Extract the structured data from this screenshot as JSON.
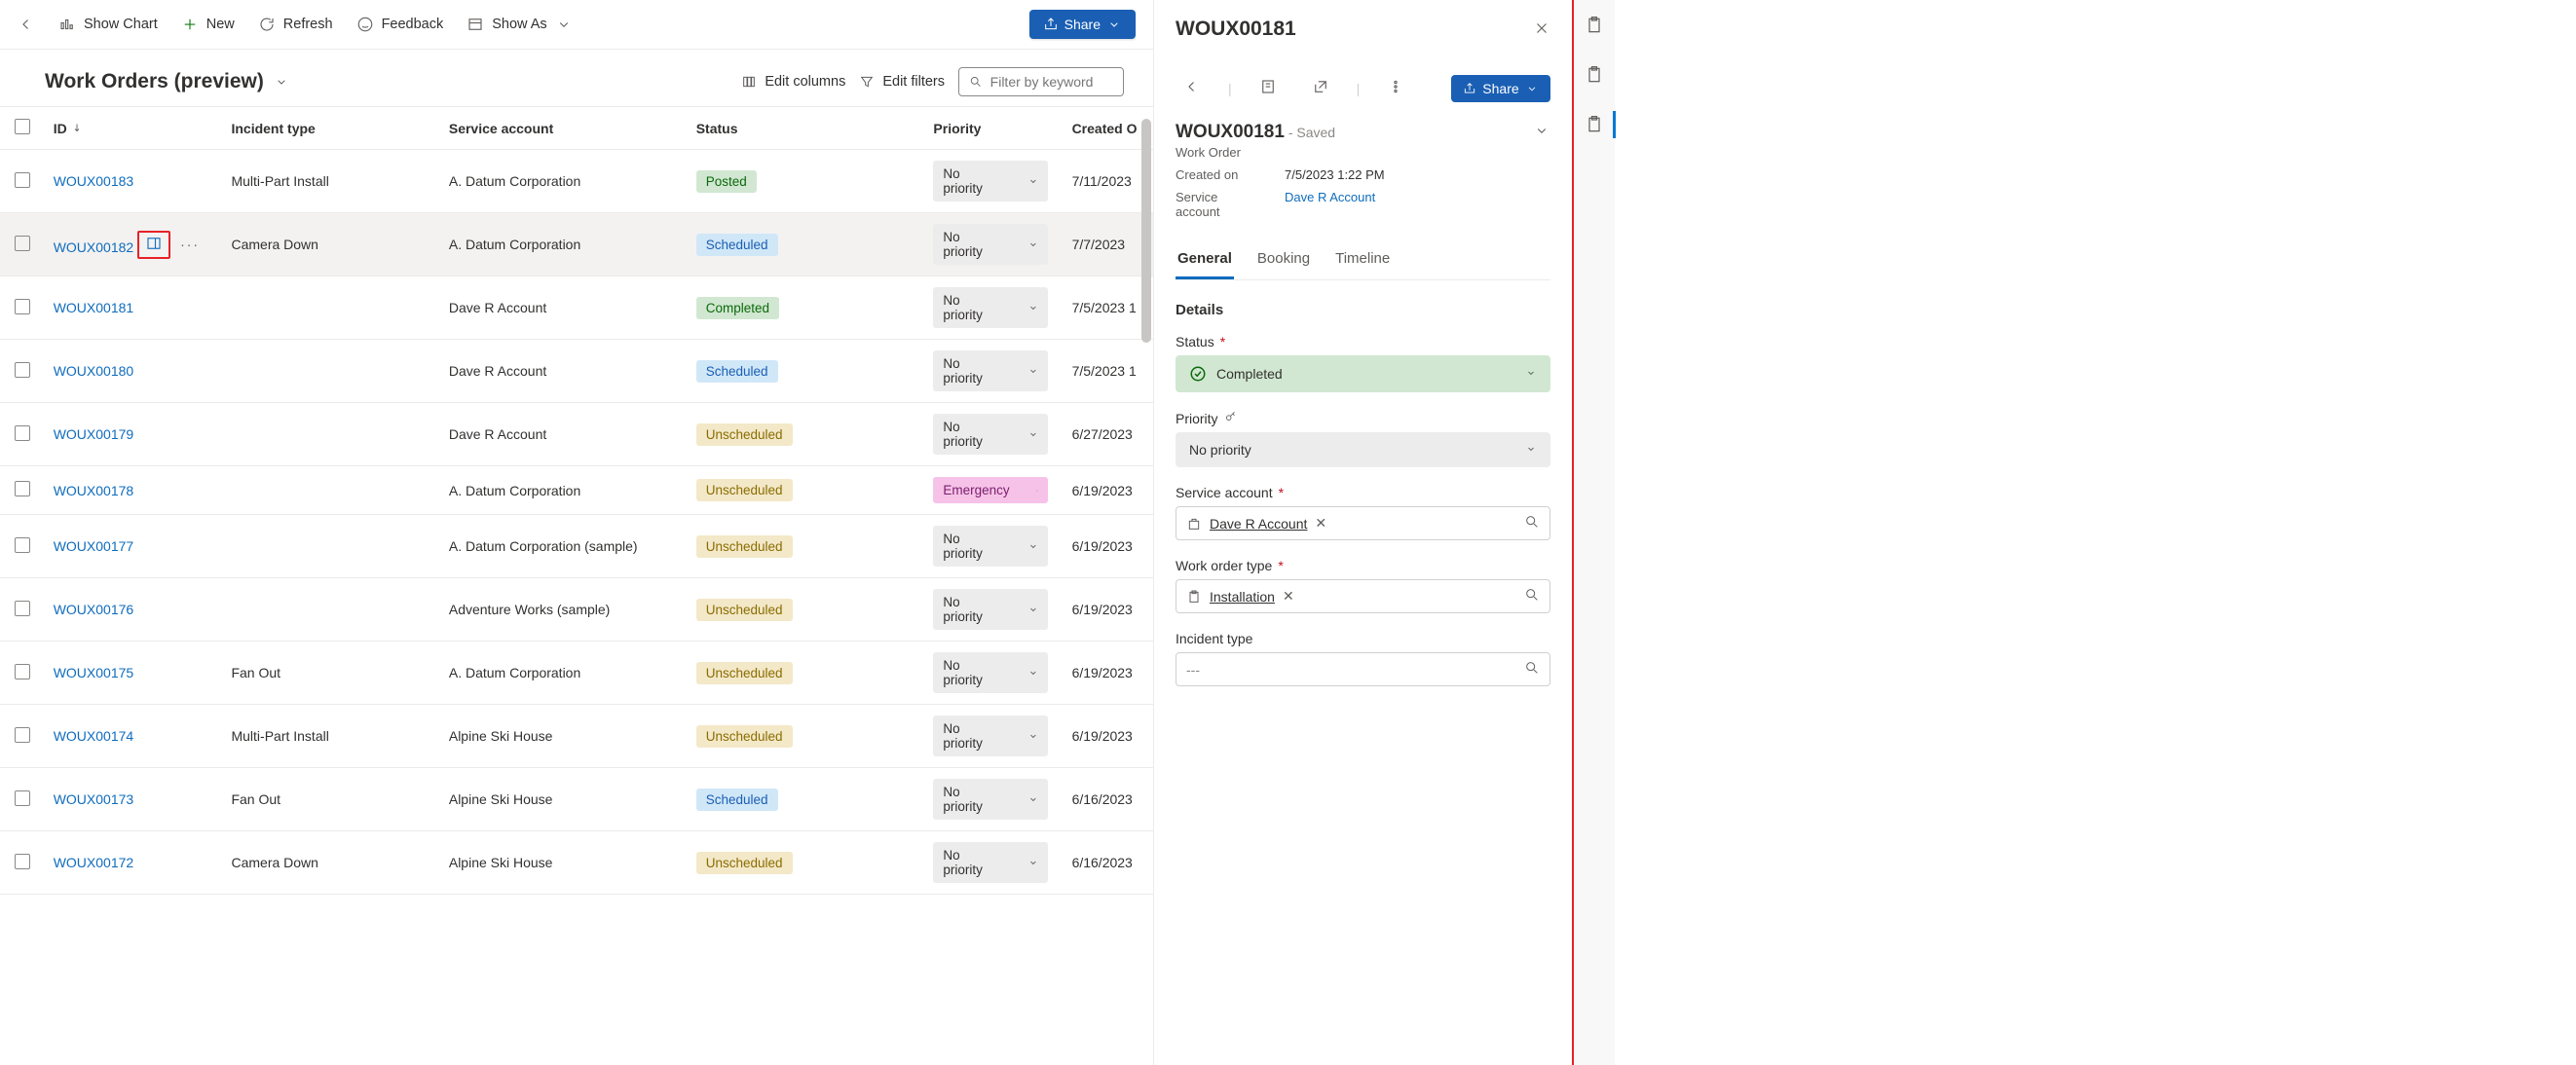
{
  "commandBar": {
    "showChart": "Show Chart",
    "new": "New",
    "refresh": "Refresh",
    "feedback": "Feedback",
    "showAs": "Show As",
    "share": "Share"
  },
  "viewHeader": {
    "title": "Work Orders (preview)",
    "editColumns": "Edit columns",
    "editFilters": "Edit filters",
    "filterPlaceholder": "Filter by keyword"
  },
  "columns": {
    "id": "ID",
    "incident": "Incident type",
    "account": "Service account",
    "status": "Status",
    "priority": "Priority",
    "created": "Created O"
  },
  "rows": [
    {
      "id": "WOUX00183",
      "incident": "Multi-Part Install",
      "account": "A. Datum Corporation",
      "status": "Posted",
      "statusClass": "st-posted",
      "priority": "No priority",
      "prioClass": "",
      "created": "7/11/2023"
    },
    {
      "id": "WOUX00182",
      "hover": true,
      "actions": true,
      "incident": "Camera Down",
      "account": "A. Datum Corporation",
      "status": "Scheduled",
      "statusClass": "st-scheduled",
      "priority": "No priority",
      "prioClass": "",
      "created": "7/7/2023"
    },
    {
      "id": "WOUX00181",
      "incident": "",
      "account": "Dave R Account",
      "status": "Completed",
      "statusClass": "st-completed",
      "priority": "No priority",
      "prioClass": "",
      "created": "7/5/2023 1"
    },
    {
      "id": "WOUX00180",
      "incident": "",
      "account": "Dave R Account",
      "status": "Scheduled",
      "statusClass": "st-scheduled",
      "priority": "No priority",
      "prioClass": "",
      "created": "7/5/2023 1"
    },
    {
      "id": "WOUX00179",
      "incident": "",
      "account": "Dave R Account",
      "status": "Unscheduled",
      "statusClass": "st-unscheduled",
      "priority": "No priority",
      "prioClass": "",
      "created": "6/27/2023"
    },
    {
      "id": "WOUX00178",
      "incident": "",
      "account": "A. Datum Corporation",
      "status": "Unscheduled",
      "statusClass": "st-unscheduled",
      "priority": "Emergency",
      "prioClass": "emerg",
      "created": "6/19/2023"
    },
    {
      "id": "WOUX00177",
      "incident": "",
      "account": "A. Datum Corporation (sample)",
      "status": "Unscheduled",
      "statusClass": "st-unscheduled",
      "priority": "No priority",
      "prioClass": "",
      "created": "6/19/2023"
    },
    {
      "id": "WOUX00176",
      "incident": "",
      "account": "Adventure Works (sample)",
      "status": "Unscheduled",
      "statusClass": "st-unscheduled",
      "priority": "No priority",
      "prioClass": "",
      "created": "6/19/2023"
    },
    {
      "id": "WOUX00175",
      "incident": "Fan Out",
      "account": "A. Datum Corporation",
      "status": "Unscheduled",
      "statusClass": "st-unscheduled",
      "priority": "No priority",
      "prioClass": "",
      "created": "6/19/2023"
    },
    {
      "id": "WOUX00174",
      "incident": "Multi-Part Install",
      "account": "Alpine Ski House",
      "status": "Unscheduled",
      "statusClass": "st-unscheduled",
      "priority": "No priority",
      "prioClass": "",
      "created": "6/19/2023"
    },
    {
      "id": "WOUX00173",
      "incident": "Fan Out",
      "account": "Alpine Ski House",
      "status": "Scheduled",
      "statusClass": "st-scheduled",
      "priority": "No priority",
      "prioClass": "",
      "created": "6/16/2023"
    },
    {
      "id": "WOUX00172",
      "incident": "Camera Down",
      "account": "Alpine Ski House",
      "status": "Unscheduled",
      "statusClass": "st-unscheduled",
      "priority": "No priority",
      "prioClass": "",
      "created": "6/16/2023"
    }
  ],
  "panel": {
    "headerTitle": "WOUX00181",
    "share": "Share",
    "recordTitle": "WOUX00181",
    "savedSuffix": " - Saved",
    "entityName": "Work Order",
    "createdOnLabel": "Created on",
    "createdOn": "7/5/2023 1:22 PM",
    "serviceAccountLabel": "Service account",
    "serviceAccountLink": "Dave R Account",
    "tabs": {
      "general": "General",
      "booking": "Booking",
      "timeline": "Timeline"
    },
    "sectionDetails": "Details",
    "statusLabel": "Status",
    "statusValue": "Completed",
    "priorityLabel": "Priority",
    "priorityValue": "No priority",
    "serviceAcctFieldLabel": "Service account",
    "serviceAcctFieldValue": "Dave R Account",
    "workOrderTypeLabel": "Work order type",
    "workOrderTypeValue": "Installation",
    "incidentTypeLabel": "Incident type",
    "incidentPlaceholder": "---"
  }
}
